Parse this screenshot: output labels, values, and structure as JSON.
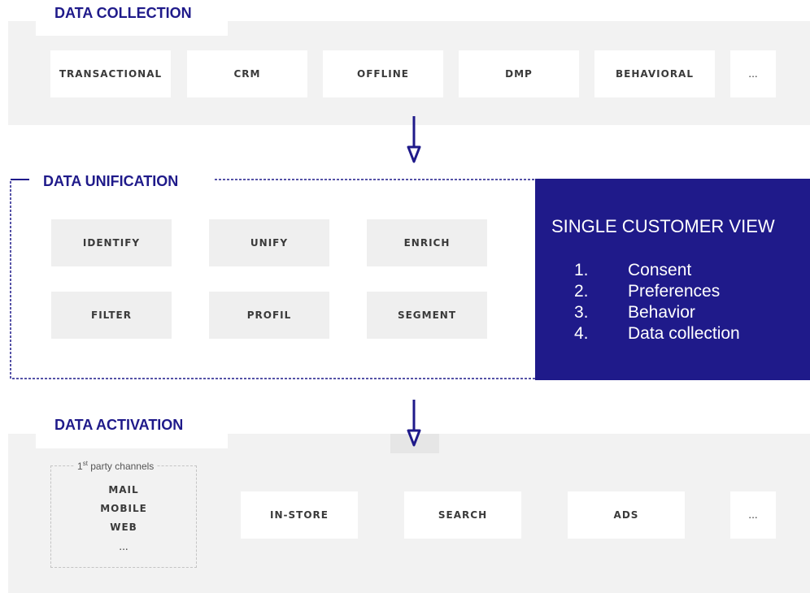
{
  "collection": {
    "title": "DATA COLLECTION",
    "items": [
      "TRANSACTIONAL",
      "CRM",
      "OFFLINE",
      "DMP",
      "BEHAVIORAL",
      "..."
    ]
  },
  "unification": {
    "title": "DATA UNIFICATION",
    "items": [
      "IDENTIFY",
      "UNIFY",
      "ENRICH",
      "FILTER",
      "PROFIL",
      "SEGMENT"
    ]
  },
  "single_customer_view": {
    "title": "SINGLE CUSTOMER VIEW",
    "items": [
      {
        "num": "1.",
        "label": "Consent"
      },
      {
        "num": "2.",
        "label": "Preferences"
      },
      {
        "num": "3.",
        "label": "Behavior"
      },
      {
        "num": "4.",
        "label": "Data collection"
      }
    ]
  },
  "activation": {
    "title": "DATA ACTIVATION",
    "first_party": {
      "title_main": "1",
      "title_sup": "st",
      "title_rest": " party channels",
      "items": [
        "MAIL",
        "MOBILE",
        "WEB",
        "..."
      ]
    },
    "items": [
      "IN-STORE",
      "SEARCH",
      "ADS",
      "..."
    ]
  },
  "colors": {
    "accent": "#1f1a8a",
    "panel": "#f2f2f2",
    "box": "#ffffff"
  }
}
